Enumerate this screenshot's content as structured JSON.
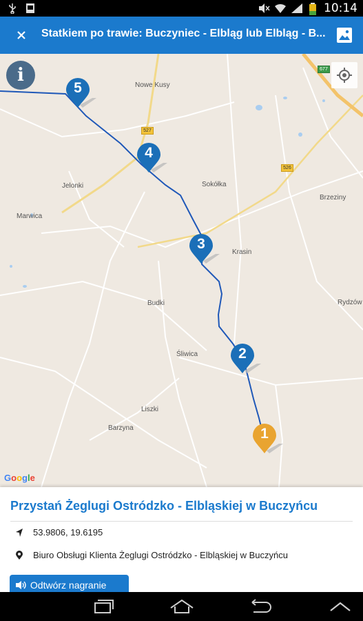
{
  "status_bar": {
    "time": "10:14",
    "icons": [
      "usb-icon",
      "image-notification-icon",
      "mute-icon",
      "wifi-icon",
      "signal-icon",
      "battery-icon"
    ]
  },
  "app_bar": {
    "title": "Statkiem po trawie:  Buczyniec - Elbląg lub Elbląg - B...",
    "close_icon": "close-icon",
    "gallery_icon": "image-gallery-icon",
    "background": "#1b7acd"
  },
  "map": {
    "places": [
      "Nowe Kusy",
      "Jelonki",
      "Marwica",
      "Sokółka",
      "Brzeziny",
      "Krasin",
      "Budki",
      "Rydzów",
      "Śliwica",
      "Liszki",
      "Barzyna"
    ],
    "road_numbers": [
      "677",
      "527",
      "526"
    ],
    "markers": [
      {
        "label": "5",
        "color": "#1b6fb8"
      },
      {
        "label": "4",
        "color": "#1b6fb8"
      },
      {
        "label": "3",
        "color": "#1b6fb8"
      },
      {
        "label": "2",
        "color": "#1b6fb8"
      },
      {
        "label": "1",
        "color": "#e9a430"
      }
    ],
    "route_color": "#1f58b8",
    "google_logo": [
      "G",
      "o",
      "o",
      "g",
      "l",
      "e"
    ]
  },
  "panel": {
    "title": "Przystań Żeglugi Ostródzko - Elbląskiej w Buczyńcu",
    "coordinates": "53.9806, 19.6195",
    "address": "Biuro Obsługi Klienta Żeglugi Ostródzko - Elbląskiej w Buczyńcu",
    "play_button": "Odtwórz nagranie"
  },
  "nav_bar": {
    "buttons": [
      "recent-apps-icon",
      "home-icon",
      "back-icon",
      "chevron-up-icon"
    ]
  }
}
